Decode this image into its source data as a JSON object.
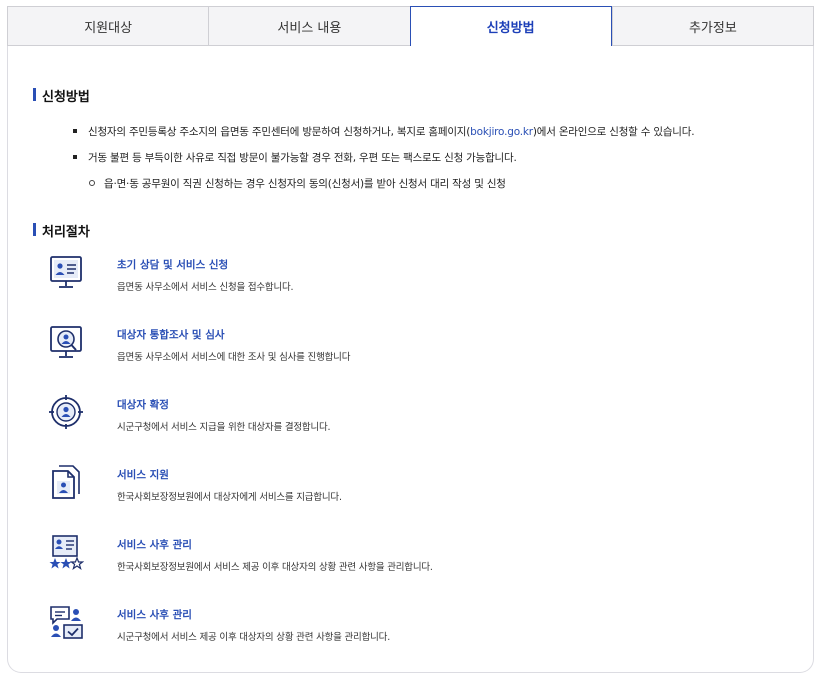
{
  "tabs": [
    {
      "label": "지원대상",
      "active": false
    },
    {
      "label": "서비스 내용",
      "active": false
    },
    {
      "label": "신청방법",
      "active": true
    },
    {
      "label": "추가정보",
      "active": false
    }
  ],
  "apply": {
    "heading": "신청방법",
    "bullet1_before": "신청자의 주민등록상 주소지의 읍면동 주민센터에 방문하여 신청하거나, 복지로 홈페이지(",
    "bullet1_link": "bokjiro.go.kr",
    "bullet1_after": ")에서 온라인으로 신청할 수 있습니다.",
    "bullet2": "거동 불편 등 부득이한 사유로 직접 방문이 불가능할 경우 전화, 우편 또는 팩스로도 신청 가능합니다.",
    "sub_bullet": "읍·면·동 공무원이 직권 신청하는 경우 신청자의 동의(신청서)를 받아 신청서 대리 작성 및 신청"
  },
  "process": {
    "heading": "처리절차",
    "steps": [
      {
        "icon": "consultation-monitor-icon",
        "title": "초기 상담 및 서비스 신청",
        "desc": "읍면동 사무소에서 서비스 신청을 접수합니다."
      },
      {
        "icon": "investigation-monitor-icon",
        "title": "대상자 통합조사 및 심사",
        "desc": "읍면동 사무소에서 서비스에 대한 조사 및 심사를 진행합니다"
      },
      {
        "icon": "target-person-icon",
        "title": "대상자 확정",
        "desc": "시군구청에서 서비스 지급을 위한 대상자를 결정합니다."
      },
      {
        "icon": "document-person-icon",
        "title": "서비스 지원",
        "desc": "한국사회보장정보원에서 대상자에게 서비스를 지급합니다."
      },
      {
        "icon": "profile-stars-icon",
        "title": "서비스 사후 관리",
        "desc": "한국사회보장정보원에서 서비스 제공 이후 대상자의 상황 관련 사항을 관리합니다."
      },
      {
        "icon": "chat-check-icon",
        "title": "서비스 사후 관리",
        "desc": "시군구청에서 서비스 제공 이후 대상자의 상황 관련 사항을 관리합니다."
      }
    ]
  },
  "colors": {
    "accent": "#2a4fb5",
    "icon": "#1e2f6b"
  }
}
